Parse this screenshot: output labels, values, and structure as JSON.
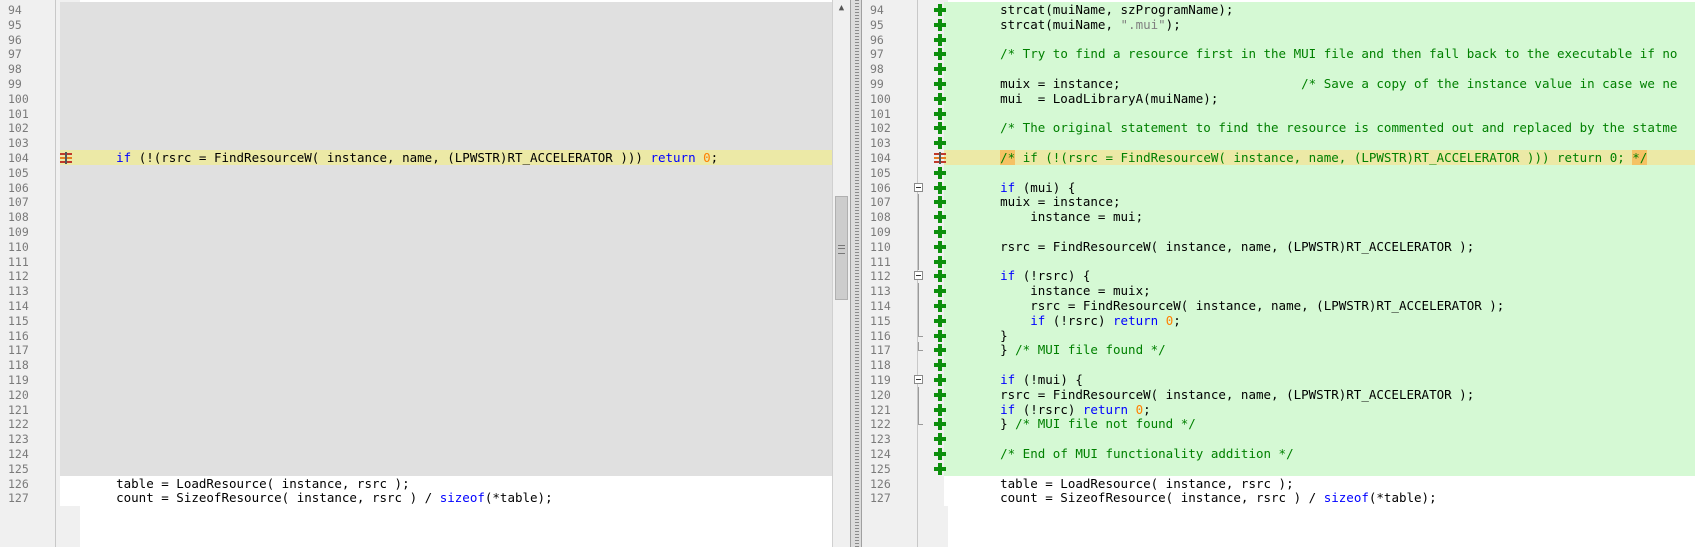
{
  "colors": {
    "added_bg": "#d5f9d4",
    "changed_bg": "#ece9a6",
    "missing_bg": "#e0e0e0",
    "normal_bg": "#ffffff",
    "changed_highlight": "#f5c264"
  },
  "left": {
    "lines": [
      {
        "num": "94",
        "type": "missing",
        "code": []
      },
      {
        "num": "95",
        "type": "missing",
        "code": []
      },
      {
        "num": "96",
        "type": "missing",
        "code": []
      },
      {
        "num": "97",
        "type": "missing",
        "code": []
      },
      {
        "num": "98",
        "type": "missing",
        "code": []
      },
      {
        "num": "99",
        "type": "missing",
        "code": []
      },
      {
        "num": "100",
        "type": "missing",
        "code": []
      },
      {
        "num": "101",
        "type": "missing",
        "code": []
      },
      {
        "num": "102",
        "type": "missing",
        "code": []
      },
      {
        "num": "103",
        "type": "missing",
        "code": []
      },
      {
        "num": "104",
        "type": "changed",
        "marker": "diff",
        "code": [
          {
            "t": "    "
          },
          {
            "t": "if",
            "c": "kw"
          },
          {
            "t": " (!(rsrc = FindResourceW( instance, name, (LPWSTR)RT_ACCELERATOR ))) "
          },
          {
            "t": "return",
            "c": "kw"
          },
          {
            "t": " "
          },
          {
            "t": "0",
            "c": "num"
          },
          {
            "t": ";"
          }
        ]
      },
      {
        "num": "105",
        "type": "missing",
        "code": []
      },
      {
        "num": "106",
        "type": "missing",
        "code": []
      },
      {
        "num": "107",
        "type": "missing",
        "code": []
      },
      {
        "num": "108",
        "type": "missing",
        "code": []
      },
      {
        "num": "109",
        "type": "missing",
        "code": []
      },
      {
        "num": "110",
        "type": "missing",
        "code": []
      },
      {
        "num": "111",
        "type": "missing",
        "code": []
      },
      {
        "num": "112",
        "type": "missing",
        "code": []
      },
      {
        "num": "113",
        "type": "missing",
        "code": []
      },
      {
        "num": "114",
        "type": "missing",
        "code": []
      },
      {
        "num": "115",
        "type": "missing",
        "code": []
      },
      {
        "num": "116",
        "type": "missing",
        "code": []
      },
      {
        "num": "117",
        "type": "missing",
        "code": []
      },
      {
        "num": "118",
        "type": "missing",
        "code": []
      },
      {
        "num": "119",
        "type": "missing",
        "code": []
      },
      {
        "num": "120",
        "type": "missing",
        "code": []
      },
      {
        "num": "121",
        "type": "missing",
        "code": []
      },
      {
        "num": "122",
        "type": "missing",
        "code": []
      },
      {
        "num": "123",
        "type": "missing",
        "code": []
      },
      {
        "num": "124",
        "type": "missing",
        "code": []
      },
      {
        "num": "125",
        "type": "missing",
        "code": []
      },
      {
        "num": "126",
        "type": "normal",
        "code": [
          {
            "t": "    table = LoadResource( instance, rsrc );"
          }
        ]
      },
      {
        "num": "127",
        "type": "normal",
        "code": [
          {
            "t": "    count = SizeofResource( instance, rsrc ) / "
          },
          {
            "t": "sizeof",
            "c": "kw"
          },
          {
            "t": "(*table);"
          }
        ]
      }
    ]
  },
  "right": {
    "lines": [
      {
        "num": "94",
        "type": "added",
        "code": [
          {
            "t": "    strcat(muiName, szProgramName);"
          }
        ]
      },
      {
        "num": "95",
        "type": "added",
        "code": [
          {
            "t": "    strcat(muiName, "
          },
          {
            "t": "\".mui\"",
            "c": "str"
          },
          {
            "t": ");"
          }
        ]
      },
      {
        "num": "96",
        "type": "added",
        "code": []
      },
      {
        "num": "97",
        "type": "added",
        "code": [
          {
            "t": "    "
          },
          {
            "t": "/* Try to find a resource first in the MUI file and then fall back to the executable if no",
            "c": "cm"
          }
        ]
      },
      {
        "num": "98",
        "type": "added",
        "code": []
      },
      {
        "num": "99",
        "type": "added",
        "code": [
          {
            "t": "    muix = instance;                        "
          },
          {
            "t": "/* Save a copy of the instance value in case we ne",
            "c": "cm"
          }
        ]
      },
      {
        "num": "100",
        "type": "added",
        "code": [
          {
            "t": "    mui  = LoadLibraryA(muiName);"
          }
        ]
      },
      {
        "num": "101",
        "type": "added",
        "code": []
      },
      {
        "num": "102",
        "type": "added",
        "code": [
          {
            "t": "    "
          },
          {
            "t": "/* The original statement to find the resource is commented out and replaced by the statme",
            "c": "cm"
          }
        ]
      },
      {
        "num": "103",
        "type": "added",
        "code": []
      },
      {
        "num": "104",
        "type": "changed",
        "marker": "diff",
        "code": [
          {
            "t": "    "
          },
          {
            "t": "/*",
            "c": "cm",
            "hl": true
          },
          {
            "t": " if (!(rsrc = FindResourceW( instance, name, (LPWSTR)RT_ACCELERATOR ))) return 0; ",
            "c": "cm"
          },
          {
            "t": "*/",
            "c": "cm",
            "hl": true
          }
        ]
      },
      {
        "num": "105",
        "type": "added",
        "code": []
      },
      {
        "num": "106",
        "type": "added",
        "fold": "start",
        "code": [
          {
            "t": "    "
          },
          {
            "t": "if",
            "c": "kw"
          },
          {
            "t": " (mui) {"
          }
        ]
      },
      {
        "num": "107",
        "type": "added",
        "fold": "mid",
        "code": [
          {
            "t": "    muix = instance;"
          }
        ]
      },
      {
        "num": "108",
        "type": "added",
        "fold": "mid",
        "code": [
          {
            "t": "        instance = mui;"
          }
        ]
      },
      {
        "num": "109",
        "type": "added",
        "fold": "mid",
        "code": []
      },
      {
        "num": "110",
        "type": "added",
        "fold": "mid",
        "code": [
          {
            "t": "    rsrc = FindResourceW( instance, name, (LPWSTR)RT_ACCELERATOR );"
          }
        ]
      },
      {
        "num": "111",
        "type": "added",
        "fold": "mid",
        "code": []
      },
      {
        "num": "112",
        "type": "added",
        "fold": "start",
        "code": [
          {
            "t": "    "
          },
          {
            "t": "if",
            "c": "kw"
          },
          {
            "t": " (!rsrc) {"
          }
        ]
      },
      {
        "num": "113",
        "type": "added",
        "fold": "mid",
        "code": [
          {
            "t": "        instance = muix;"
          }
        ]
      },
      {
        "num": "114",
        "type": "added",
        "fold": "mid",
        "code": [
          {
            "t": "        rsrc = FindResourceW( instance, name, (LPWSTR)RT_ACCELERATOR );"
          }
        ]
      },
      {
        "num": "115",
        "type": "added",
        "fold": "mid",
        "code": [
          {
            "t": "        "
          },
          {
            "t": "if",
            "c": "kw"
          },
          {
            "t": " (!rsrc) "
          },
          {
            "t": "return",
            "c": "kw"
          },
          {
            "t": " "
          },
          {
            "t": "0",
            "c": "num"
          },
          {
            "t": ";"
          }
        ]
      },
      {
        "num": "116",
        "type": "added",
        "fold": "end",
        "code": [
          {
            "t": "    }"
          }
        ]
      },
      {
        "num": "117",
        "type": "added",
        "fold": "end",
        "code": [
          {
            "t": "    } "
          },
          {
            "t": "/* MUI file found */",
            "c": "cm"
          }
        ]
      },
      {
        "num": "118",
        "type": "added",
        "code": []
      },
      {
        "num": "119",
        "type": "added",
        "fold": "start",
        "code": [
          {
            "t": "    "
          },
          {
            "t": "if",
            "c": "kw"
          },
          {
            "t": " (!mui) {"
          }
        ]
      },
      {
        "num": "120",
        "type": "added",
        "fold": "mid",
        "code": [
          {
            "t": "    rsrc = FindResourceW( instance, name, (LPWSTR)RT_ACCELERATOR );"
          }
        ]
      },
      {
        "num": "121",
        "type": "added",
        "fold": "mid",
        "code": [
          {
            "t": "    "
          },
          {
            "t": "if",
            "c": "kw"
          },
          {
            "t": " (!rsrc) "
          },
          {
            "t": "return",
            "c": "kw"
          },
          {
            "t": " "
          },
          {
            "t": "0",
            "c": "num"
          },
          {
            "t": ";"
          }
        ]
      },
      {
        "num": "122",
        "type": "added",
        "fold": "end",
        "code": [
          {
            "t": "    } "
          },
          {
            "t": "/* MUI file not found */",
            "c": "cm"
          }
        ]
      },
      {
        "num": "123",
        "type": "added",
        "code": []
      },
      {
        "num": "124",
        "type": "added",
        "code": [
          {
            "t": "    "
          },
          {
            "t": "/* End of MUI functionality addition */",
            "c": "cm"
          }
        ]
      },
      {
        "num": "125",
        "type": "added",
        "code": []
      },
      {
        "num": "126",
        "type": "normal",
        "code": [
          {
            "t": "    table = LoadResource( instance, rsrc );"
          }
        ]
      },
      {
        "num": "127",
        "type": "normal",
        "code": [
          {
            "t": "    count = SizeofResource( instance, rsrc ) / "
          },
          {
            "t": "sizeof",
            "c": "kw"
          },
          {
            "t": "(*table);"
          }
        ]
      }
    ]
  },
  "scrollbar": {
    "up_arrow": "▲"
  }
}
